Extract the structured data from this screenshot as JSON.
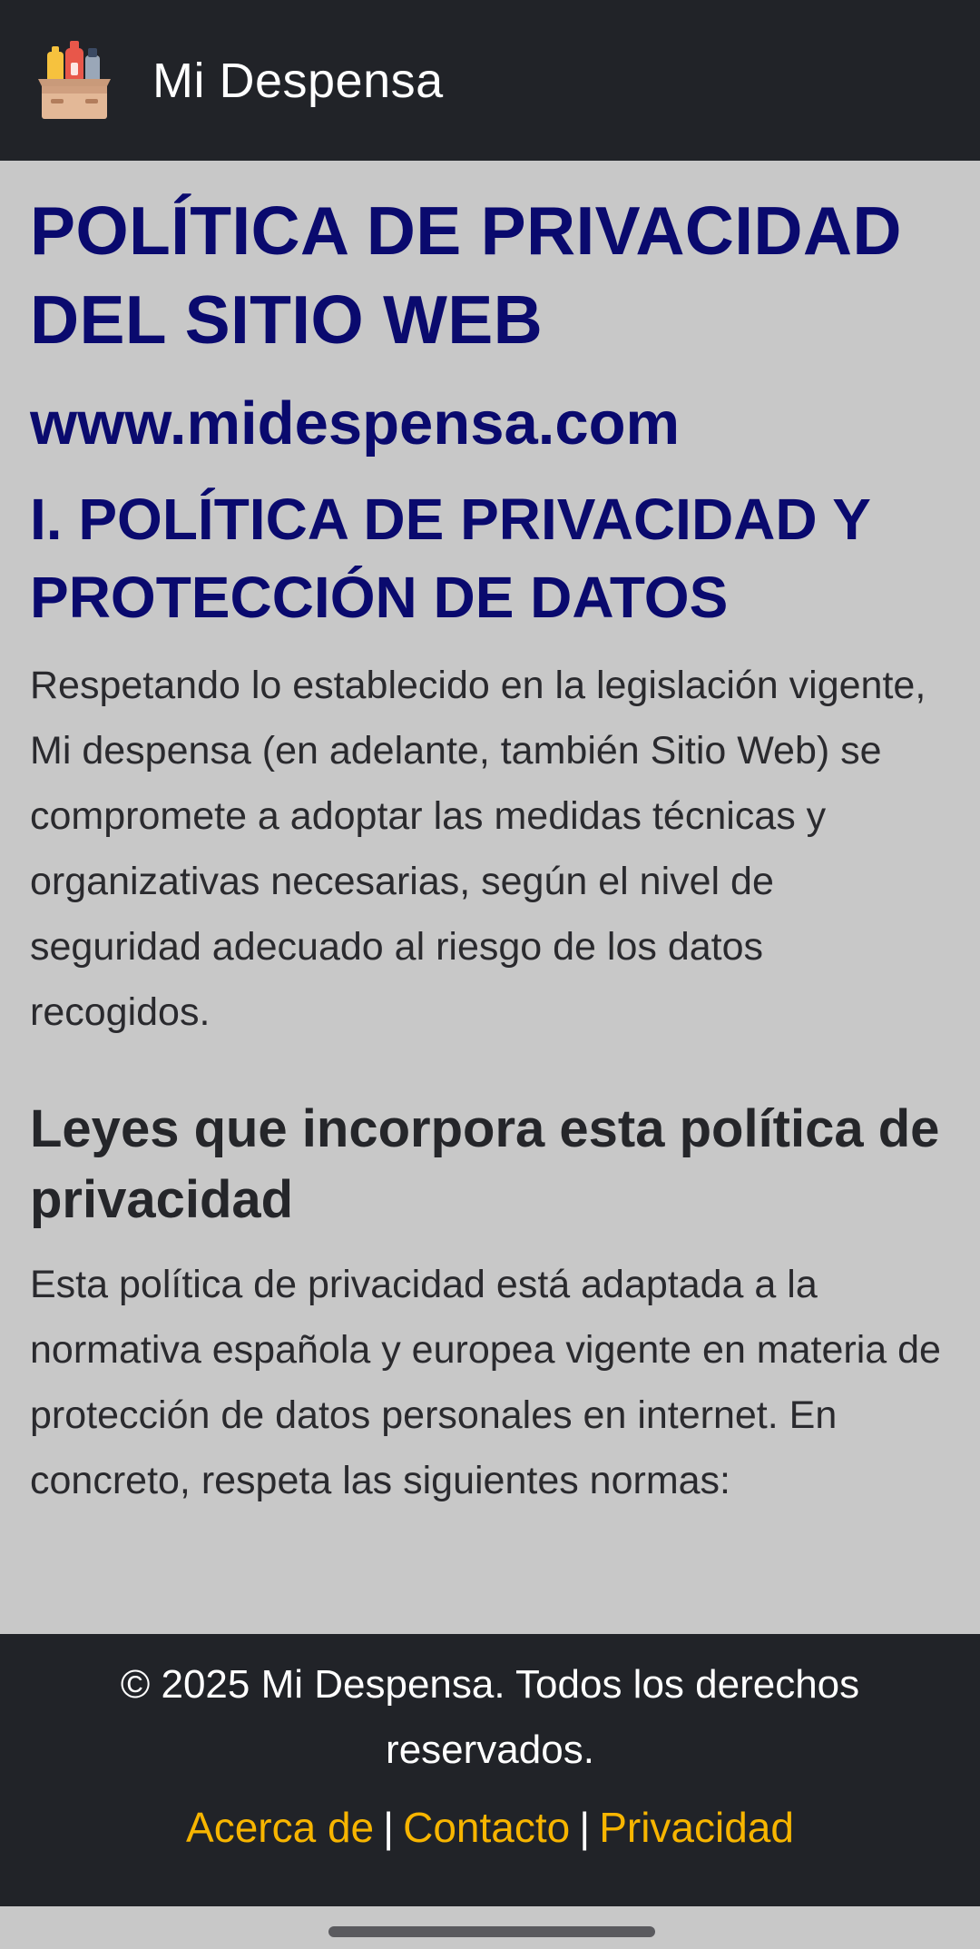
{
  "header": {
    "app_title": "Mi Despensa",
    "logo_icon": "pantry-box-icon"
  },
  "content": {
    "title": "POLÍTICA DE PRIVACIDAD DEL SITIO WEB",
    "site_url": "www.midespensa.com",
    "section_title": "I. POLÍTICA DE PRIVACIDAD Y PROTECCIÓN DE DATOS",
    "section_paragraph": "Respetando lo establecido en la legislación vigente, Mi despensa (en adelante, también Sitio Web) se compromete a adoptar las medidas técnicas y organizativas necesarias, según el nivel de seguridad adecuado al riesgo de los datos recogidos.",
    "laws_title": "Leyes que incorpora esta política de privacidad",
    "laws_paragraph": "Esta política de privacidad está adaptada a la normativa española y europea vigente en materia de protección de datos personales en internet. En concreto, respeta las siguientes normas:"
  },
  "footer": {
    "copyright": "© 2025 Mi Despensa. Todos los derechos reservados.",
    "separator": "|",
    "links": {
      "about": "Acerca de",
      "contact": "Contacto",
      "privacy": "Privacidad"
    }
  },
  "colors": {
    "header_bg": "#212328",
    "page_bg": "#c8c8c8",
    "heading": "#0a0a6e",
    "link": "#f7b500"
  }
}
